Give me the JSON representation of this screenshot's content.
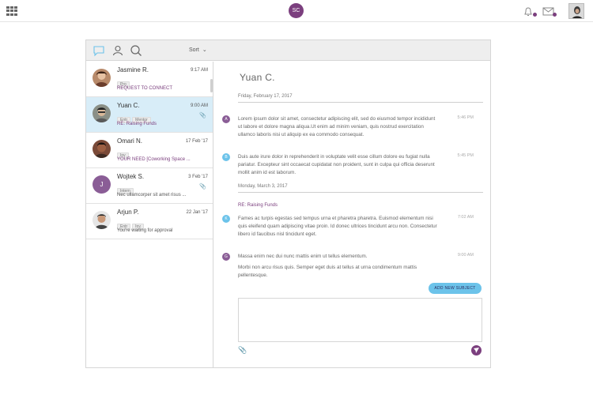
{
  "topbar": {
    "logo_initials": "SC",
    "colors": {
      "brand": "#7b3f7e",
      "accent": "#6cc3ea"
    }
  },
  "toolbar": {
    "sort_label": "Sort",
    "icons": [
      "chat-icon",
      "user-icon",
      "search-icon"
    ]
  },
  "conversations": [
    {
      "name": "Jasmine R.",
      "time": "9:17 AM",
      "tags": [
        "Pro"
      ],
      "preview": "REQUEST TO CONNECT",
      "preview_style": "purple",
      "active": false,
      "attachment": false
    },
    {
      "name": "Yuan C.",
      "time": "9:00 AM",
      "tags": [
        "Entr",
        "Mentor"
      ],
      "preview": "RE: Raising Funds",
      "preview_style": "purple",
      "active": true,
      "attachment": true
    },
    {
      "name": "Omari N.",
      "time": "17 Feb '17",
      "tags": [
        "Inv"
      ],
      "preview": "YOUR NEED [Coworking Space ...",
      "preview_style": "purple",
      "active": false,
      "attachment": false
    },
    {
      "name": "Wojtek S.",
      "time": "3 Feb '17",
      "tags": [
        "Intern"
      ],
      "preview": "Nec ullamcorper sit amet risus ...",
      "preview_style": "normal",
      "active": false,
      "attachment": true,
      "initial": "J"
    },
    {
      "name": "Arjun P.",
      "time": "22 Jan '17",
      "tags": [
        "Entr",
        "Inv"
      ],
      "preview": "You're waiting for approval",
      "preview_style": "normal",
      "active": false,
      "attachment": false
    }
  ],
  "thread": {
    "title": "Yuan C.",
    "date1": "Friday, February 17, 2017",
    "date2": "Monday, March 3, 2017",
    "subject": "RE: Raising Funds",
    "messages": [
      {
        "initial": "A",
        "color": "#8a5d96",
        "time": "5:46 PM",
        "text": "Lorem ipsum dolor sit amet, consectetur adipiscing elit, sed do eiusmod tempor incididunt ut labore et dolore magna aliqua.Ut enim ad minim veniam, quis nostrud exercitation ullamco laboris nisi ut aliquip ex ea commodo consequat."
      },
      {
        "initial": "B",
        "color": "#6cc3ea",
        "time": "5:45 PM",
        "text": "Duis aute irure dolor in reprehenderit in voluptate velit esse cillum dolore eu fugiat nulla pariatur. Excepteur sint occaecat cupidatat non proident, sunt in culpa qui officia deserunt mollit anim id est laborum."
      },
      {
        "initial": "K",
        "color": "#6cc3ea",
        "time": "7:02 AM",
        "text": "Fames ac turpis egestas sed tempus urna et pharetra pharetra. Euismod elementum nisi quis eleifend quam adipiscing vitae proin. Id donec ultrices tincidunt arcu non. Consectetur libero id faucibus nisl tincidunt eget."
      },
      {
        "initial": "G",
        "color": "#8a5d96",
        "time": "9:00 AM",
        "text": "Massa enim nec dui nunc mattis enim ut tellus elementum.",
        "text2": "Morbi non arcu risus quis. Semper eget duis at tellus at urna condimentum mattis pellentesque."
      }
    ],
    "add_subject_label": "ADD NEW SUBJECT"
  }
}
